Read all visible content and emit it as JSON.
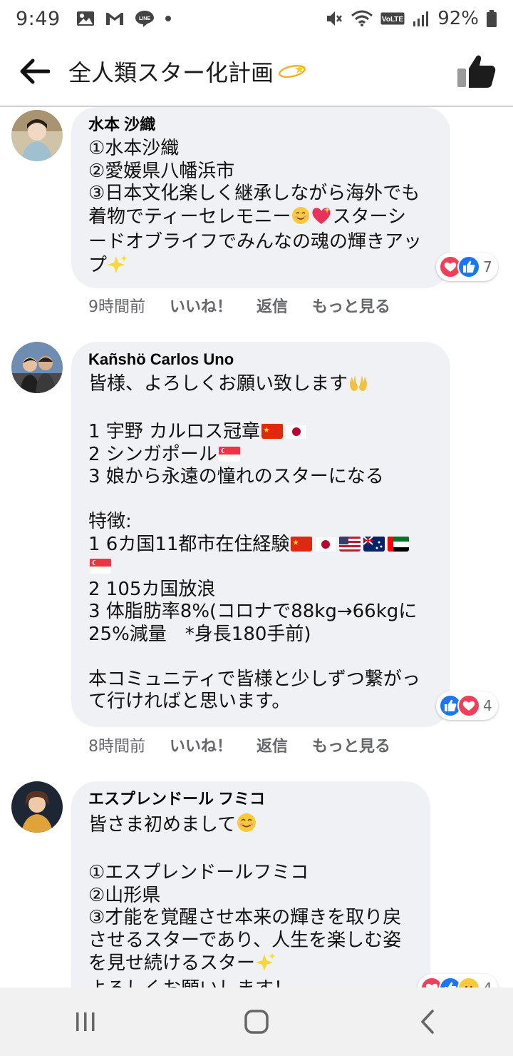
{
  "status": {
    "time": "9:49",
    "battery": "92%",
    "left_icons": [
      "image-icon",
      "gmail-icon",
      "line-icon",
      "dot-icon"
    ],
    "right_icons": [
      "mute-icon",
      "wifi-icon",
      "volte-icon",
      "signal-icon",
      "battery-icon"
    ],
    "volte_label": "VoLTE",
    "line_label": "LINE"
  },
  "header": {
    "title": "全人類スター化計画",
    "back_icon": "back-arrow-icon",
    "like_icon": "thumbs-up-icon"
  },
  "comments": [
    {
      "author": "水本 沙織",
      "lines": [
        "①水本沙織",
        "②愛媛県八幡浜市",
        "③日本文化楽しく継承しながら海外でも",
        "着物でティーセレモニー",
        "スターシ",
        "ードオブライフでみんなの魂の輝きアッ",
        "プ"
      ],
      "time": "9時間前",
      "like_label": "いいね！",
      "reply_label": "返信",
      "more_label": "もっと見る",
      "reactions": [
        "love",
        "like"
      ],
      "reaction_count": "7"
    },
    {
      "author": "Kañshö Carlos Uno",
      "lines": [
        "皆様、よろしくお願い致します",
        "",
        "1 宇野 カルロス冠章",
        "2 シンガポール",
        "3 娘から永遠の憧れのスターになる",
        "",
        "特徴:",
        "1 6カ国11都市在住経験",
        "",
        "2 105カ国放浪",
        "3 体脂肪率8%(コロナで88kg→66kgに",
        "25%減量　*身長180手前)",
        "",
        "本コミュニティで皆様と少しずつ繋がっ",
        "て行ければと思います。"
      ],
      "time": "8時間前",
      "like_label": "いいね！",
      "reply_label": "返信",
      "more_label": "もっと見る",
      "reactions": [
        "like",
        "love"
      ],
      "reaction_count": "4"
    },
    {
      "author": "エスプレンドール フミコ",
      "lines": [
        "皆さま初めまして",
        "",
        "①エスプレンドールフミコ",
        "②山形県",
        "③才能を覚醒させ本来の輝きを取り戻",
        "させるスターであり、人生を楽しむ姿",
        "を見せ続けるスター",
        "よろしくお願いします！"
      ],
      "reactions": [
        "love",
        "like",
        "care"
      ],
      "reaction_count": "4"
    }
  ],
  "navbar": {
    "items": [
      "recent-apps-icon",
      "home-icon",
      "back-icon"
    ]
  },
  "colors": {
    "bubble": "#eff1f4",
    "meta_text": "#65676b",
    "like_blue": "#1877f2",
    "love_red": "#f33e58"
  }
}
